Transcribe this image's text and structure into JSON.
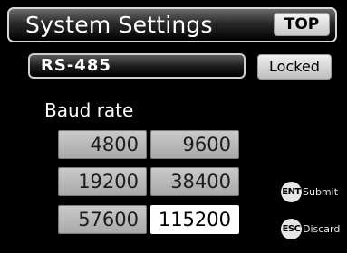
{
  "header": {
    "title": "System Settings",
    "top_button": "TOP"
  },
  "port": {
    "label": "RS-485",
    "lock_button": "Locked"
  },
  "section_label": "Baud rate",
  "baud_rates": [
    {
      "label": "4800",
      "selected": false
    },
    {
      "label": "9600",
      "selected": false
    },
    {
      "label": "19200",
      "selected": false
    },
    {
      "label": "38400",
      "selected": false
    },
    {
      "label": "57600",
      "selected": false
    },
    {
      "label": "115200",
      "selected": true
    }
  ],
  "controls": {
    "submit": {
      "key": "ENT",
      "label": "Submit"
    },
    "discard": {
      "key": "ESC",
      "label": "Discard"
    }
  }
}
